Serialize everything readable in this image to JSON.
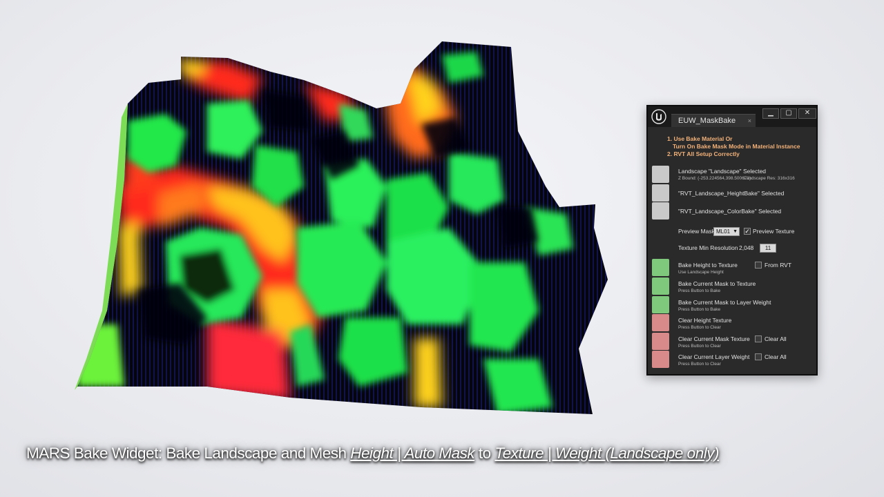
{
  "window": {
    "tab_title": "EUW_MaskBake",
    "tab_close": "×",
    "minimize_label": "▁",
    "maximize_label": "▢",
    "close_label": "✕",
    "logo_icon": "unreal-logo-icon"
  },
  "instructions": [
    "1. Use Bake Material Or",
    "Turn On Bake Mask Mode in Material Instance",
    "2. RVT All Setup Correctly"
  ],
  "status": {
    "landscape": "Landscape \"Landscape\" Selected",
    "z_bound": "Z Bound: (-253.224564,398.500671)",
    "landscape_res": "Landscape Res: 316x316",
    "height_bake": "\"RVT_Landscape_HeightBake\" Selected",
    "color_bake": "\"RVT_Landscape_ColorBake\" Selected"
  },
  "preview": {
    "label": "Preview Mask",
    "mask_value": "ML01",
    "texture_label": "Preview Texture",
    "texture_checked": true
  },
  "resolution": {
    "label": "Texture Min Resolution",
    "value": "2,048",
    "spin_value": "11"
  },
  "actions": [
    {
      "title": "Bake Height to Texture",
      "hint": "Use Landscape Height",
      "option": "From RVT"
    },
    {
      "title": "Bake Current Mask to Texture",
      "hint": "Press Button to Bake",
      "option": ""
    },
    {
      "title": "Bake Current Mask to Layer Weight",
      "hint": "Press Button to Bake",
      "option": ""
    },
    {
      "title": "Clear Height Texture",
      "hint": "Press Button to Clear",
      "option": ""
    },
    {
      "title": "Clear Current Mask Texture",
      "hint": "Press Button to Clear",
      "option": "Clear All"
    },
    {
      "title": "Clear Current Layer Weight",
      "hint": "Press Button to Clear",
      "option": "Clear All"
    }
  ],
  "colors": {
    "bake": "#7fc97c",
    "clear": "#d88a8a",
    "status": "#c9c9c9",
    "instruction": "#f3b27a"
  },
  "caption": {
    "part1": "MARS Bake Widget: Bake Landscape and Mesh ",
    "part2": "Height | Auto Mask",
    "part3": " to ",
    "part4": "Texture | Weight (Landscape only)"
  }
}
